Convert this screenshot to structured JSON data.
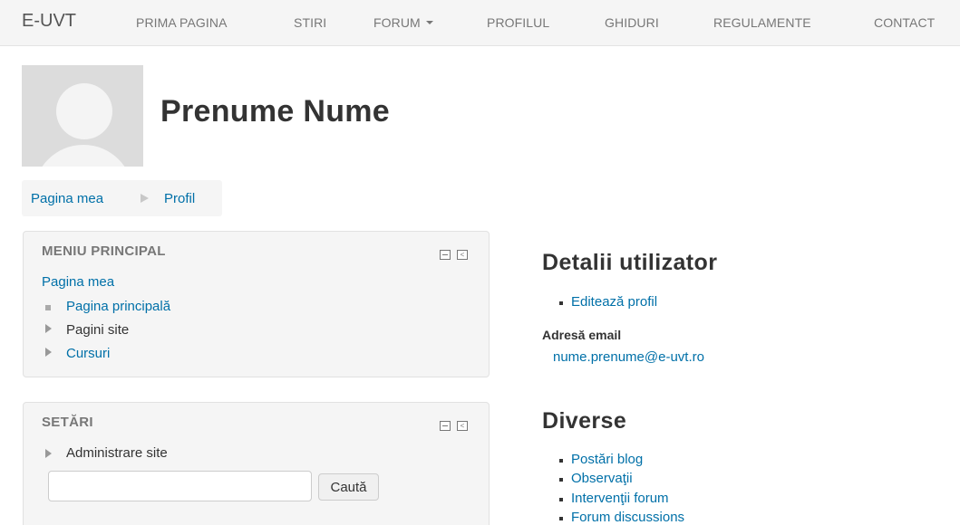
{
  "navbar": {
    "brand": "E-UVT",
    "items": [
      {
        "label": "PRIMA PAGINA"
      },
      {
        "label": "STIRI"
      },
      {
        "label": "FORUM"
      },
      {
        "label": "PROFILUL"
      },
      {
        "label": "GHIDURI"
      },
      {
        "label": "REGULAMENTE"
      },
      {
        "label": "CONTACT"
      }
    ]
  },
  "profile": {
    "name": "Prenume Nume"
  },
  "breadcrumb": {
    "items": [
      "Pagina mea",
      "Profil"
    ]
  },
  "main_menu": {
    "title": "MENIU PRINCIPAL",
    "top_link": "Pagina mea",
    "items": [
      "Pagina principală",
      "Pagini site",
      "Cursuri"
    ]
  },
  "settings": {
    "title": "SETĂRI",
    "item": "Administrare site",
    "search_value": "",
    "search_button": "Caută"
  },
  "user_details": {
    "title": "Detalii utilizator",
    "edit_link": "Editează profil",
    "email_label": "Adresă email",
    "email_value": "nume.prenume@e-uvt.ro"
  },
  "misc": {
    "title": "Diverse",
    "links": [
      "Postări blog",
      "Observaţii",
      "Intervenţii forum",
      "Forum discussions"
    ]
  },
  "colors": {
    "link": "#0070a8",
    "navbar_bg": "#f5f5f5",
    "block_bg": "#f5f5f5"
  }
}
